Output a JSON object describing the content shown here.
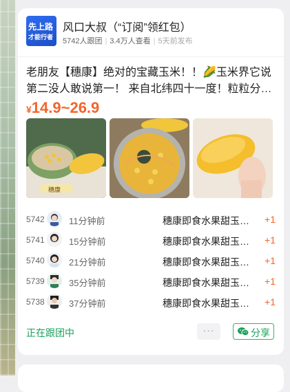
{
  "group": {
    "logo_line1": "先上路",
    "logo_line2": "才能行者",
    "title": "风口大叔（“订阅”领红包）",
    "followers": "5742人跟团",
    "views": "3.4万人查看",
    "published": "5天前发布"
  },
  "post": {
    "description": "老朋友【穗康】绝对的宝藏玉米！！🌽玉米界它说第二没人敢说第一！ 来自北纬四十一度！粒粒分…",
    "price_currency": "¥",
    "price_range": "14.9~26.9"
  },
  "photos": [
    {
      "label": "穗康"
    },
    {
      "label": ""
    },
    {
      "label": ""
    }
  ],
  "orders": [
    {
      "no": "5742",
      "time": "11分钟前",
      "item": "穗康即食水果甜玉…",
      "qty": "+1"
    },
    {
      "no": "5741",
      "time": "15分钟前",
      "item": "穗康即食水果甜玉…",
      "qty": "+1"
    },
    {
      "no": "5740",
      "time": "21分钟前",
      "item": "穗康即食水果甜玉…",
      "qty": "+1"
    },
    {
      "no": "5739",
      "time": "35分钟前",
      "item": "穗康即食水果甜玉…",
      "qty": "+1"
    },
    {
      "no": "5738",
      "time": "37分钟前",
      "item": "穗康即食水果甜玉…",
      "qty": "+1"
    }
  ],
  "footer": {
    "status": "正在跟团中",
    "more_label": "···",
    "share_label": "分享"
  },
  "colors": {
    "accent_price": "#f2652b",
    "accent_green": "#1aa05a",
    "logo_blue": "#2f6cf0"
  }
}
